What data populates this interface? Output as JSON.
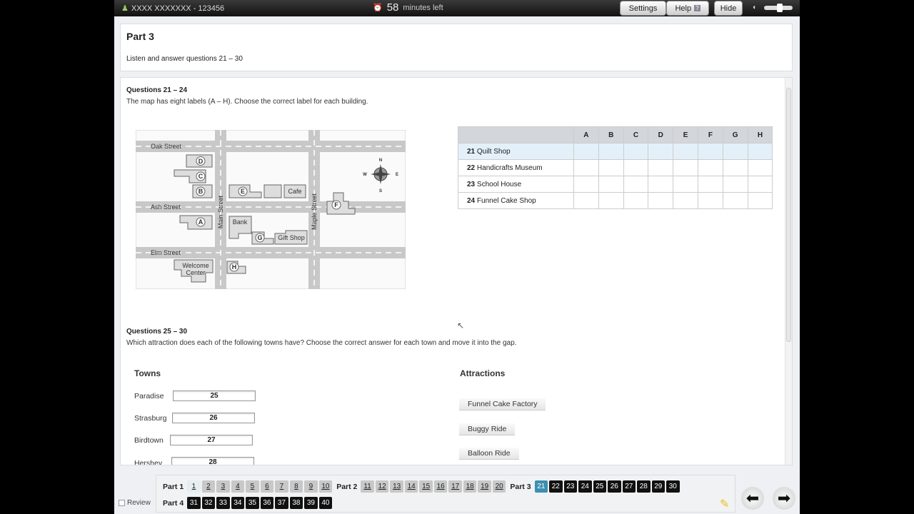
{
  "topbar": {
    "candidate": "XXXX XXXXXXX - 123456",
    "minutes": "58",
    "minutes_label": "minutes left",
    "settings": "Settings",
    "help": "Help",
    "help_badge": "?",
    "hide": "Hide"
  },
  "header": {
    "title": "Part 3",
    "instruction": "Listen and answer questions 21 – 30"
  },
  "q1": {
    "heading": "Questions 21 – 24",
    "text": "The map has eight labels (A – H). Choose the correct label for each building."
  },
  "map": {
    "streets": [
      "Oak Street",
      "Ash Street",
      "Elm Street",
      "Main Street",
      "Maple Street"
    ],
    "labels": [
      "A",
      "B",
      "C",
      "D",
      "E",
      "F",
      "G",
      "H"
    ],
    "buildings": [
      "Cafe",
      "Bank",
      "Gift Shop",
      "Welcome",
      "Center"
    ],
    "compass": [
      "N",
      "S",
      "E",
      "W"
    ]
  },
  "grid": {
    "columns": [
      "A",
      "B",
      "C",
      "D",
      "E",
      "F",
      "G",
      "H"
    ],
    "rows": [
      {
        "num": "21",
        "label": "Quilt Shop"
      },
      {
        "num": "22",
        "label": "Handicrafts Museum"
      },
      {
        "num": "23",
        "label": "School House"
      },
      {
        "num": "24",
        "label": "Funnel Cake Shop"
      }
    ]
  },
  "q2": {
    "heading": "Questions 25 – 30",
    "text": "Which attraction does each of the following towns have? Choose the correct answer for each town and move it into the gap."
  },
  "towns": {
    "heading": "Towns",
    "items": [
      {
        "name": "Paradise",
        "gap": "25"
      },
      {
        "name": "Strasburg",
        "gap": "26"
      },
      {
        "name": "Birdtown",
        "gap": "27"
      },
      {
        "name": "Hershey",
        "gap": "28"
      }
    ]
  },
  "attractions": {
    "heading": "Attractions",
    "items": [
      "Funnel Cake Factory",
      "Buggy Ride",
      "Balloon Ride"
    ]
  },
  "nav": {
    "review": "Review",
    "parts": [
      {
        "label": "Part 1",
        "questions": [
          "1",
          "2",
          "3",
          "4",
          "5",
          "6",
          "7",
          "8",
          "9",
          "10"
        ],
        "state": "done"
      },
      {
        "label": "Part 2",
        "questions": [
          "11",
          "12",
          "13",
          "14",
          "15",
          "16",
          "17",
          "18",
          "19",
          "20"
        ],
        "state": "done"
      },
      {
        "label": "Part 3",
        "questions": [
          "21",
          "22",
          "23",
          "24",
          "25",
          "26",
          "27",
          "28",
          "29",
          "30"
        ],
        "state": "todo",
        "current": "21"
      },
      {
        "label": "Part 4",
        "questions": [
          "31",
          "32",
          "33",
          "34",
          "35",
          "36",
          "37",
          "38",
          "39",
          "40"
        ],
        "state": "todo"
      }
    ]
  },
  "colors": {
    "current": "#3c8fb0",
    "selected_row": "#e3f0fa"
  }
}
